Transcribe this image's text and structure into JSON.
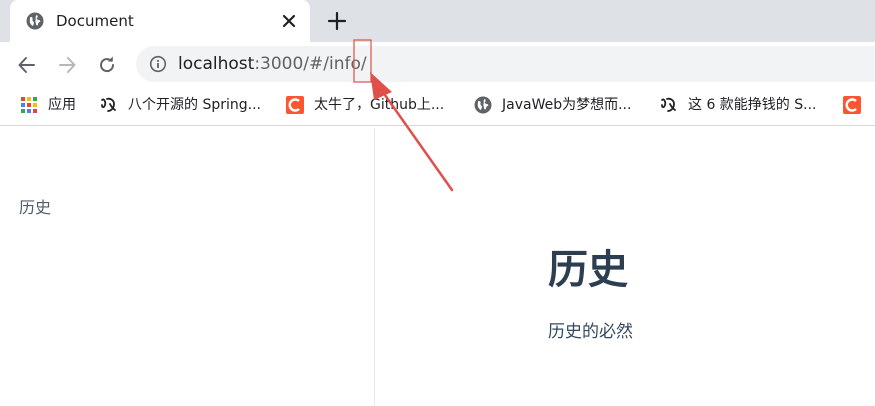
{
  "browser": {
    "tab": {
      "title": "Document",
      "favicon": "globe-icon",
      "close_icon": "close-icon"
    },
    "new_tab_icon": "plus-icon",
    "nav": {
      "back_icon": "back-arrow-icon",
      "forward_icon": "forward-arrow-icon",
      "reload_icon": "reload-icon"
    },
    "address_bar": {
      "info_icon": "info-icon",
      "host": "localhost",
      "rest": ":3000/#/info/"
    }
  },
  "bookmarks": [
    {
      "label": "应用",
      "icon": "apps-grid-icon"
    },
    {
      "label": "八个开源的 Spring...",
      "icon": "bookmark-logo-icon"
    },
    {
      "label": "太牛了，Github上...",
      "icon": "csdn-c-icon"
    },
    {
      "label": "JavaWeb为梦想而...",
      "icon": "globe-icon"
    },
    {
      "label": "这 6 款能挣钱的 S...",
      "icon": "bookmark-logo-icon"
    },
    {
      "label": "",
      "icon": "csdn-c-icon"
    }
  ],
  "sidebar": {
    "item": "历史"
  },
  "main": {
    "title": "历史",
    "text": "历史的必然"
  },
  "colors": {
    "annotation": "#e0504a",
    "heading": "#2c3e50",
    "csdn": "#fc5531"
  }
}
